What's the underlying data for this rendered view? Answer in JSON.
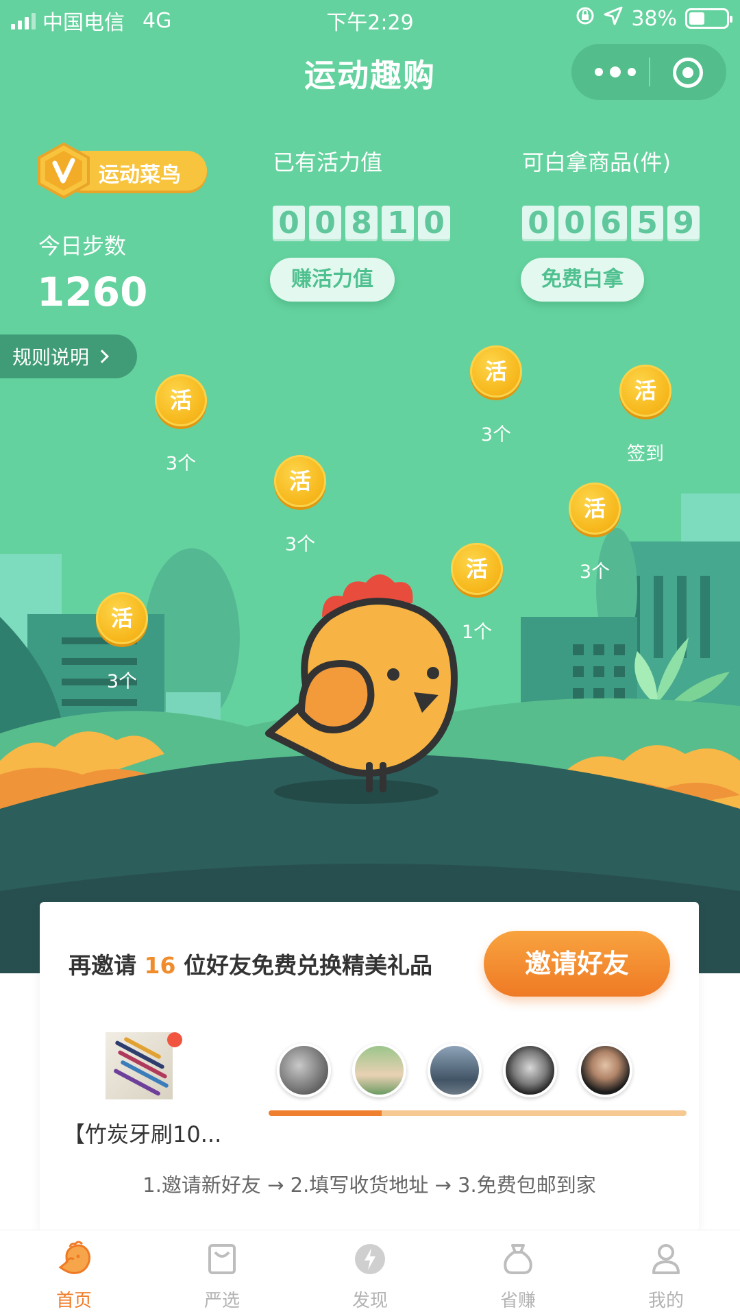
{
  "status_bar": {
    "carrier": "中国电信",
    "network": "4G",
    "time": "下午2:29",
    "battery": "38%",
    "battery_level": 0.38
  },
  "nav": {
    "title": "运动趣购",
    "menu_icon": "more-dots-icon",
    "close_icon": "target-icon"
  },
  "user": {
    "level_badge": "运动菜鸟",
    "steps_label": "今日步数",
    "steps_value": "1260",
    "rules_label": "规则说明"
  },
  "vitality": {
    "title": "已有活力值",
    "digits": [
      "0",
      "0",
      "8",
      "1",
      "0"
    ],
    "button": "赚活力值"
  },
  "free_items": {
    "title": "可白拿商品(件)",
    "digits": [
      "0",
      "0",
      "6",
      "5",
      "9"
    ],
    "button": "免费白拿"
  },
  "coins": [
    {
      "glyph": "活",
      "label": "3个"
    },
    {
      "glyph": "活",
      "label": "3个"
    },
    {
      "glyph": "活",
      "label": "签到"
    },
    {
      "glyph": "活",
      "label": "3个"
    },
    {
      "glyph": "活",
      "label": "3个"
    },
    {
      "glyph": "活",
      "label": "1个"
    },
    {
      "glyph": "活",
      "label": "3个"
    }
  ],
  "invite": {
    "text_prefix": "再邀请",
    "count": "16",
    "text_suffix": "位好友免费兑换精美礼品",
    "button": "邀请好友",
    "product_name": "【竹炭牙刷10...",
    "progress": 0.27,
    "flow": "1.邀请新好友 → 2.填写收货地址 → 3.免费包邮到家"
  },
  "tabs": [
    {
      "label": "首页",
      "icon": "chick-home-icon",
      "active": true
    },
    {
      "label": "严选",
      "icon": "shopping-bag-icon",
      "active": false
    },
    {
      "label": "发现",
      "icon": "lightning-icon",
      "active": false
    },
    {
      "label": "省赚",
      "icon": "money-bag-icon",
      "active": false
    },
    {
      "label": "我的",
      "icon": "user-icon",
      "active": false
    }
  ],
  "colors": {
    "brand_green": "#64d29e",
    "accent_orange": "#ef7a25",
    "coin_gold": "#f7b91e"
  }
}
